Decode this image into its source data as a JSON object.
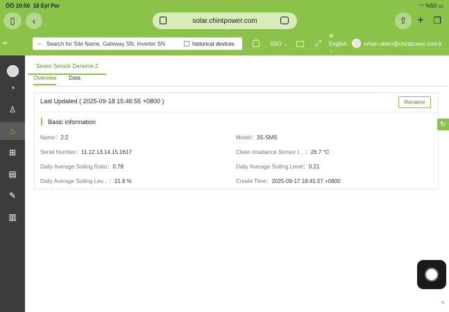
{
  "statusbar": {
    "time": "ÖÖ 10:50",
    "date": "18 Eyl Per",
    "battery": "%50"
  },
  "browser": {
    "url": "solar.chintpower.com"
  },
  "header": {
    "search_placeholder": "Search for Site Name, Gateway SN, Inverter SN",
    "historical_label": "historical devices",
    "sso_label": "SSO",
    "language": "English",
    "user_email": "erhan.okten@chintpower.com.tr"
  },
  "breadcrumb_tab": "Seven Sensör Deneme:2",
  "tabs": [
    "Overview",
    "Data"
  ],
  "card": {
    "last_updated": "Last Updated ( 2025-09-18 15:46:55 +0800 )",
    "rename_label": "Rename",
    "section_title": "Basic information",
    "fields": {
      "name_label": "Name：",
      "name_value": "2:2",
      "model_label": "Model：",
      "model_value": "3S-SMS",
      "serial_label": "Serial Number：",
      "serial_value": "11.12.13.14.15.1617",
      "clean_label": "Clean Irradiance Sensor I... ：",
      "clean_value": "26.7 °C",
      "ratio_label": "Daily Average Soiling Ratio：",
      "ratio_value": "0.78",
      "level_label": "Daily Average Soiling Level：",
      "level_value": "0.21",
      "lev2_label": "Daily Average Soiling Lev... ：",
      "lev2_value": "21.8 %",
      "create_label": "Create Time：",
      "create_value": "2025-09-17 18:41:57 +0800"
    }
  }
}
